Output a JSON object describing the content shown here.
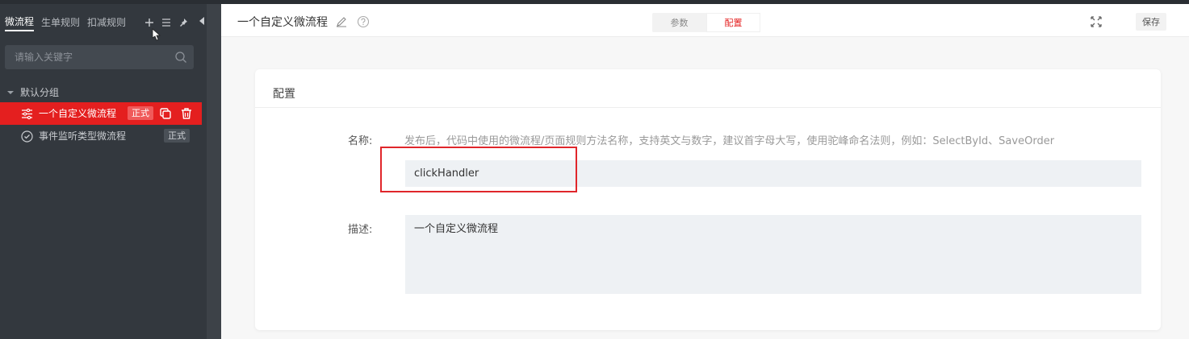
{
  "sidebar": {
    "tabs": [
      {
        "label": "微流程",
        "active": true
      },
      {
        "label": "生单规则",
        "active": false
      },
      {
        "label": "扣减规则",
        "active": false
      }
    ],
    "actions": [
      "add-icon",
      "list-icon",
      "pin-icon"
    ],
    "search": {
      "placeholder": "请输入关键字"
    },
    "group": {
      "label": "默认分组"
    },
    "items": [
      {
        "label": "一个自定义微流程",
        "badge": "正式",
        "active": true,
        "icon": "flow-icon"
      },
      {
        "label": "事件监听类型微流程",
        "badge": "正式",
        "active": false,
        "icon": "check-circle-icon"
      }
    ]
  },
  "header": {
    "title": "一个自定义微流程",
    "segments": [
      {
        "label": "参数",
        "active": false
      },
      {
        "label": "配置",
        "active": true
      }
    ],
    "save_label": "保存"
  },
  "config": {
    "title": "配置",
    "name_label": "名称:",
    "name_hint": "发布后，代码中使用的微流程/页面规则方法名称，支持英文与数字，建议首字母大写，使用驼峰命名法则，例如：SelectById、SaveOrder",
    "name_value": "clickHandler",
    "desc_label": "描述:",
    "desc_value": "一个自定义微流程"
  },
  "colors": {
    "accent": "#e41f1f",
    "sidebar_bg": "#33383e",
    "highlight_box": "#e0262b"
  }
}
